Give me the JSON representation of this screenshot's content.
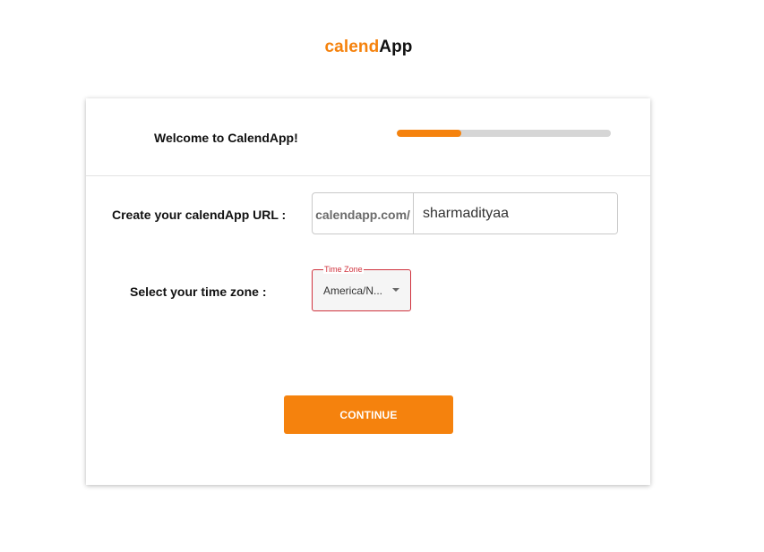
{
  "brand": {
    "part1": "calend",
    "part2": "App"
  },
  "header": {
    "welcome": "Welcome to CalendApp!",
    "progress": 0.3
  },
  "form": {
    "url_label": "Create your calendApp URL :",
    "url_prefix": "calendapp.com/",
    "url_value": "sharmadityaa",
    "tz_label": "Select your time zone :",
    "tz_field_label": "Time Zone",
    "tz_value": "America/N..."
  },
  "actions": {
    "continue_label": "CONTINUE"
  },
  "colors": {
    "accent": "#f5820d",
    "error": "#d0333e",
    "progress_track": "#d6d6d6"
  }
}
